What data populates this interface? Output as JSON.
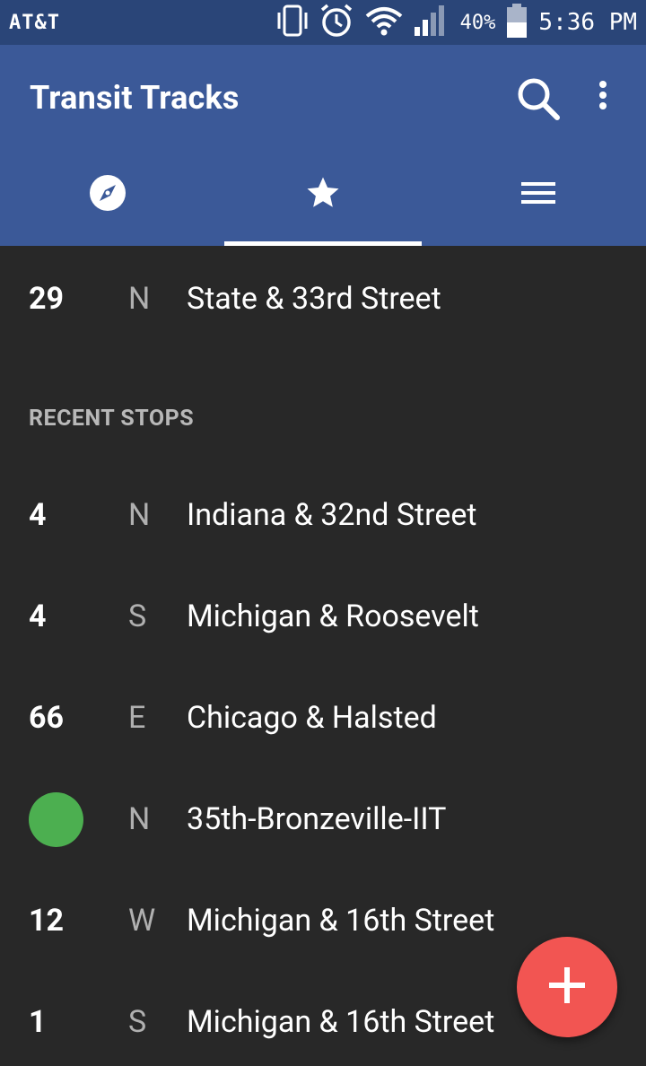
{
  "status_bar": {
    "carrier": "AT&T",
    "battery_percent": "40%",
    "time": "5:36 PM"
  },
  "app_bar": {
    "title": "Transit Tracks",
    "icons": [
      "search-icon",
      "more-vert-icon"
    ]
  },
  "tabs": [
    {
      "icon": "compass-icon",
      "active": false
    },
    {
      "icon": "star-icon",
      "active": true
    },
    {
      "icon": "menu-icon",
      "active": false
    }
  ],
  "favorites": [
    {
      "route": "29",
      "direction": "N",
      "stop": "State & 33rd Street"
    }
  ],
  "recent_header": "RECENT STOPS",
  "recent_stops": [
    {
      "route": "4",
      "direction": "N",
      "stop": "Indiana & 32nd Street"
    },
    {
      "route": "4",
      "direction": "S",
      "stop": "Michigan & Roosevelt"
    },
    {
      "route": "66",
      "direction": "E",
      "stop": "Chicago & Halsted"
    },
    {
      "route": "",
      "direction": "N",
      "stop": "35th-Bronzeville-IIT",
      "line_color": "#4caf50"
    },
    {
      "route": "12",
      "direction": "W",
      "stop": "Michigan & 16th Street"
    },
    {
      "route": "1",
      "direction": "S",
      "stop": "Michigan & 16th Street"
    }
  ],
  "colors": {
    "status_bar": "#2a4578",
    "app_bar": "#3b5998",
    "background": "#282828",
    "fab": "#f25552",
    "green_line": "#4caf50"
  }
}
